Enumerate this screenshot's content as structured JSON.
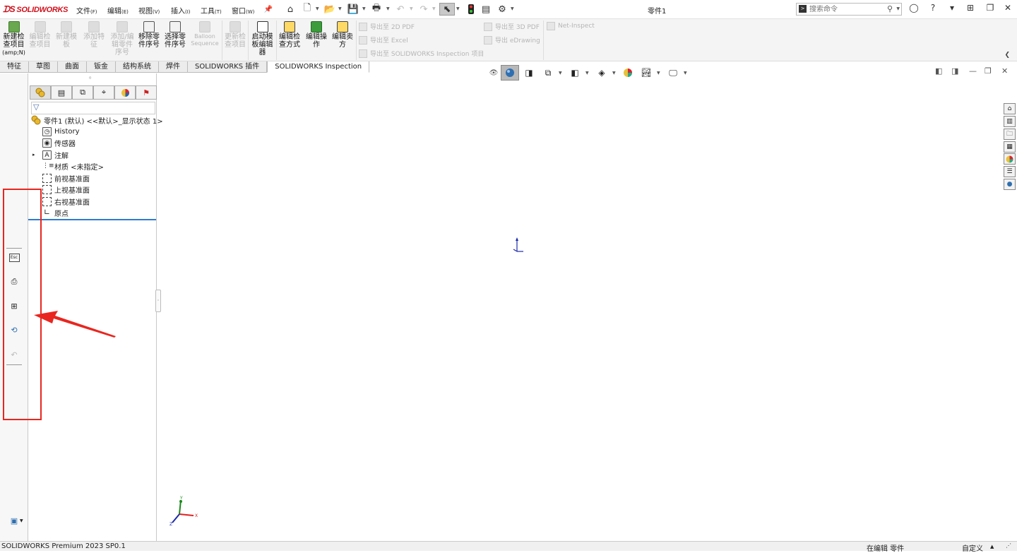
{
  "titlebar": {
    "logo": "SOLIDWORKS",
    "menus": [
      {
        "label": "文件",
        "key": "(F)"
      },
      {
        "label": "编辑",
        "key": "(E)"
      },
      {
        "label": "视图",
        "key": "(V)"
      },
      {
        "label": "插入",
        "key": "(I)"
      },
      {
        "label": "工具",
        "key": "(T)"
      },
      {
        "label": "窗口",
        "key": "(W)"
      }
    ],
    "document_title": "零件1",
    "search_placeholder": "搜索命令"
  },
  "ribbon": {
    "buttons": [
      {
        "label": "新建检查项目",
        "sub": "(amp;N)",
        "enabled": true
      },
      {
        "label": "编辑检查项目",
        "enabled": false
      },
      {
        "label": "新建模板",
        "enabled": false
      },
      {
        "label": "添加特征",
        "enabled": false
      },
      {
        "label": "添加/编辑零件序号",
        "enabled": false
      },
      {
        "label": "移除零件序号",
        "enabled": true
      },
      {
        "label": "选择零件序号",
        "enabled": true
      },
      {
        "label": "Balloon Sequence",
        "enabled": false
      },
      {
        "label": "更新检查项目",
        "enabled": false
      },
      {
        "label": "启动模板编辑器",
        "enabled": true
      },
      {
        "label": "编辑检查方式",
        "enabled": true
      },
      {
        "label": "编辑操作",
        "enabled": true
      },
      {
        "label": "编辑卖方",
        "enabled": true
      }
    ],
    "export": {
      "pdf2d": "导出至 2D PDF",
      "excel": "导出至 Excel",
      "inspection": "导出至 SOLIDWORKS Inspection 项目",
      "pdf3d": "导出至 3D PDF",
      "edrawing": "导出 eDrawing",
      "net_inspect": "Net-Inspect"
    }
  },
  "tabs": [
    "特征",
    "草图",
    "曲面",
    "钣金",
    "结构系统",
    "焊件",
    "SOLIDWORKS 插件",
    "SOLIDWORKS Inspection"
  ],
  "active_tab": "SOLIDWORKS Inspection",
  "feature_tree": {
    "root": "零件1 (默认) <<默认>_显示状态 1>",
    "items": [
      "History",
      "传感器",
      "注解",
      "材质 <未指定>",
      "前视基准面",
      "上视基准面",
      "右视基准面",
      "原点"
    ]
  },
  "triad_labels": {
    "x": "X",
    "y": "Y",
    "z": "Z"
  },
  "status": {
    "left": "SOLIDWORKS Premium 2023 SP0.1",
    "mode": "在编辑 零件",
    "custom": "自定义"
  },
  "colors": {
    "logo_red": "#d0101b",
    "annotation_red": "#e8261f",
    "separator_blue": "#2f7bd0"
  }
}
